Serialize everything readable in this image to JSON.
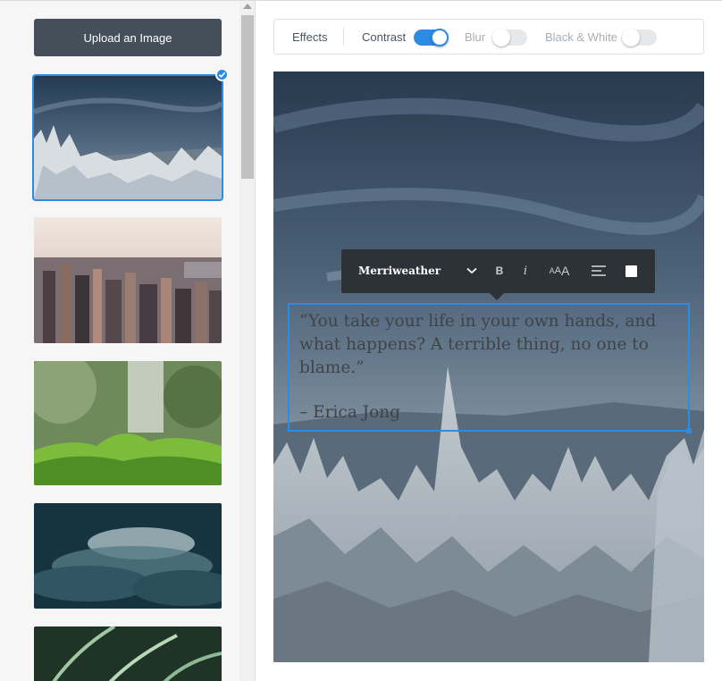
{
  "sidebar": {
    "upload_label": "Upload an Image",
    "thumbnails": [
      {
        "name": "snowy-forest",
        "selected": true
      },
      {
        "name": "city-skyline",
        "selected": false
      },
      {
        "name": "green-plant",
        "selected": false
      },
      {
        "name": "cloudy-sky",
        "selected": false
      },
      {
        "name": "fern-leaves",
        "selected": false
      }
    ]
  },
  "effects": {
    "effects_label": "Effects",
    "contrast_label": "Contrast",
    "contrast_on": true,
    "blur_label": "Blur",
    "blur_on": false,
    "bw_label": "Black & White",
    "bw_on": false
  },
  "text_toolbar": {
    "font_name": "Merriweather",
    "bold_label": "B",
    "italic_label": "i",
    "size_small": "A",
    "size_mid": "A",
    "size_large": "A"
  },
  "quote": {
    "text": "“You take your life in your own hands, and what happens? A terrible thing, no one to blame.”",
    "author": "– Erica Jong"
  },
  "colors": {
    "accent": "#2d8be4",
    "button_dark": "#454f59",
    "toolbar_dark": "#2d3238"
  }
}
